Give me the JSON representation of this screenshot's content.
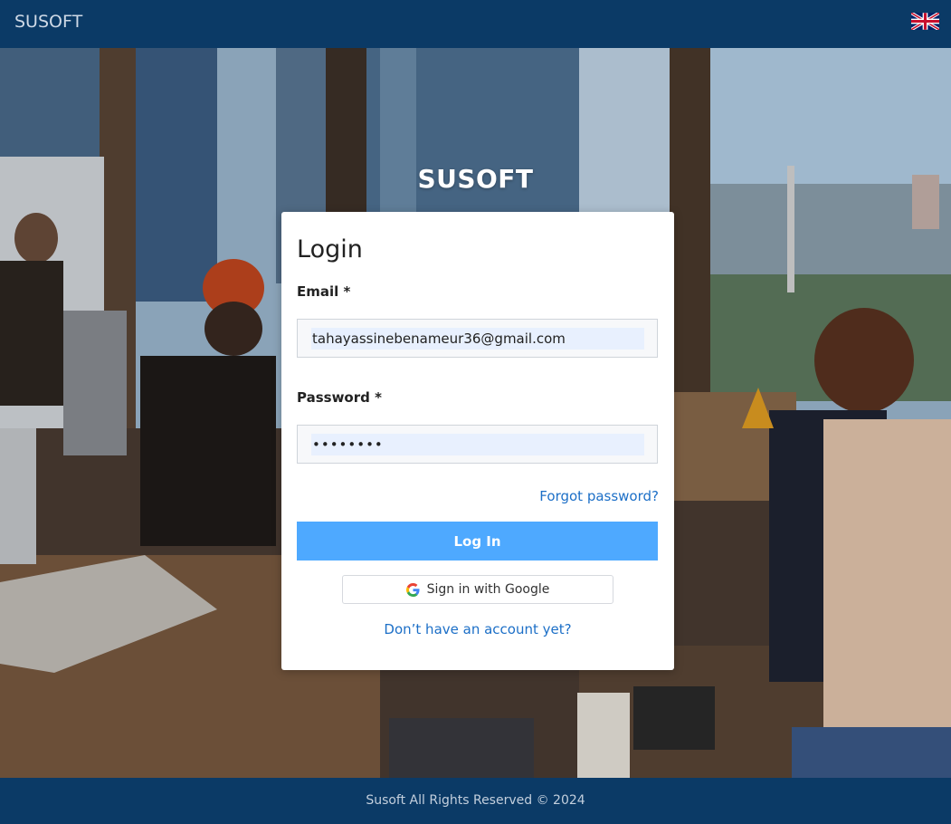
{
  "header": {
    "brand": "SUSOFT",
    "language_icon": "uk-flag-icon"
  },
  "hero": {
    "title": "SUSOFT"
  },
  "login": {
    "title": "Login",
    "email_label": "Email *",
    "email_value": "tahayassinebenameur36@gmail.com",
    "password_label": "Password *",
    "password_value": "••••••••",
    "forgot_label": "Forgot password?",
    "login_button": "Log In",
    "google_button": "Sign in with Google",
    "google_icon": "google-g-icon",
    "signup_label": "Don’t have an account yet?"
  },
  "footer": {
    "text": "Susoft All Rights Reserved © 2024"
  },
  "colors": {
    "header_bg": "#0b3a66",
    "primary_button": "#4ea9ff",
    "link": "#1c6fc7",
    "autofill_bg": "#e8f0fe"
  }
}
